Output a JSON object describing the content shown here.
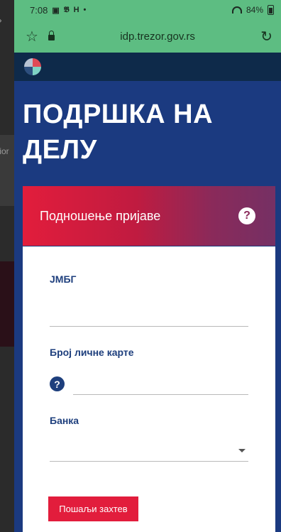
{
  "status_bar": {
    "time": "7:08",
    "battery": "84%"
  },
  "browser": {
    "url": "idp.trezor.gov.rs"
  },
  "background_app": {
    "fragment_text": "tior"
  },
  "hero": {
    "title_line1": "ПОДРШКА НА",
    "title_line2": "ДЕЛУ"
  },
  "banner": {
    "label": "Подношење пријаве",
    "help_glyph": "?"
  },
  "form": {
    "jmbg_label": "ЈМБГ",
    "jmbg_value": "",
    "licna_label": "Број личне карте",
    "licna_value": "",
    "licna_help_glyph": "?",
    "banka_label": "Банка",
    "banka_selected": "",
    "submit_label": "Пошаљи захтев"
  },
  "icons": [
    "star-icon",
    "lock-icon",
    "reload-icon",
    "pie-logo-icon",
    "help-icon",
    "caret-down-icon",
    "wifi-icon",
    "battery-icon"
  ]
}
